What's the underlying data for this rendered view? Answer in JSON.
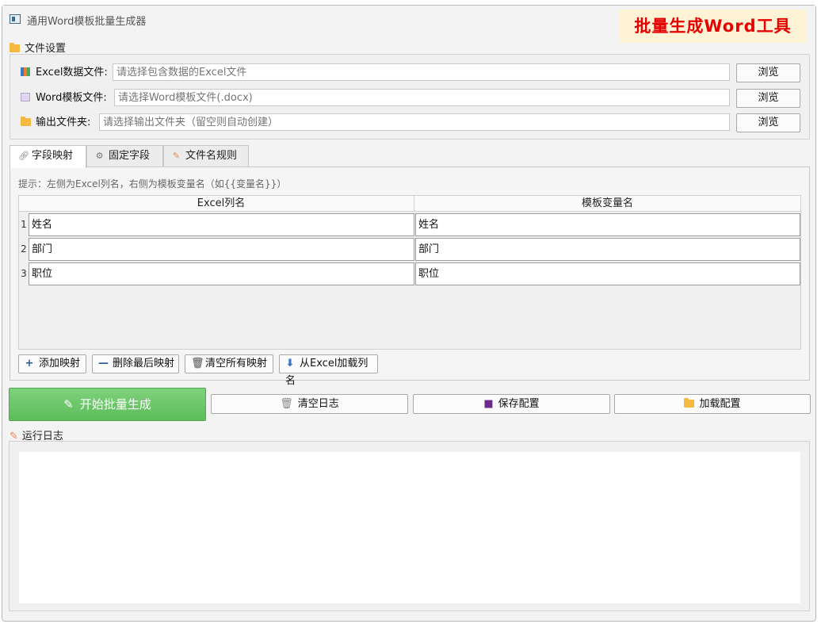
{
  "window": {
    "title": "通用Word模板批量生成器",
    "banner": "批量生成Word工具"
  },
  "file_settings": {
    "section_label": "文件设置",
    "excel": {
      "label": "Excel数据文件:",
      "placeholder": "请选择包含数据的Excel文件",
      "value": "",
      "browse": "浏览"
    },
    "word": {
      "label": "Word模板文件:",
      "placeholder": "请选择Word模板文件(.docx)",
      "value": "",
      "browse": "浏览"
    },
    "output": {
      "label": "输出文件夹:",
      "placeholder": "请选择输出文件夹（留空则自动创建）",
      "value": "",
      "browse": "浏览"
    }
  },
  "tabs": [
    {
      "label": "字段映射",
      "icon": "link-icon",
      "active": true
    },
    {
      "label": "固定字段",
      "icon": "gear-icon",
      "active": false
    },
    {
      "label": "文件名规则",
      "icon": "edit-icon",
      "active": false
    }
  ],
  "mapping": {
    "hint": "提示：左侧为Excel列名，右侧为模板变量名（如{{变量名}}）",
    "columns": [
      "Excel列名",
      "模板变量名"
    ],
    "rows": [
      {
        "num": "1",
        "excel": "姓名",
        "var": "姓名"
      },
      {
        "num": "2",
        "excel": "部门",
        "var": "部门"
      },
      {
        "num": "3",
        "excel": "职位",
        "var": "职位"
      }
    ],
    "buttons": {
      "add": "添加映射",
      "delete_last": "删除最后映射",
      "clear_all": "清空所有映射",
      "load_from_excel": "从Excel加载列名"
    }
  },
  "actions": {
    "start": "开始批量生成",
    "clear_log": "清空日志",
    "save_config": "保存配置",
    "load_config": "加载配置"
  },
  "log": {
    "section_label": "运行日志",
    "content": ""
  }
}
